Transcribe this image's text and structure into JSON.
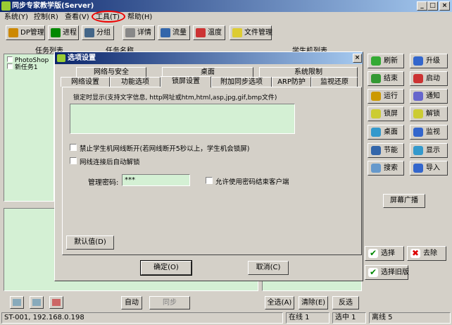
{
  "window": {
    "title": "同步专家教学版(Server)"
  },
  "menu": {
    "m0": "系统(Y)",
    "m1": "控制(R)",
    "m2": "查看(V)",
    "m3": "工具(T)",
    "m4": "帮助(H)"
  },
  "toolbar": {
    "t0": "DP管理",
    "t1": "进程",
    "t2": "分组",
    "t3": "详情",
    "t4": "流量",
    "t5": "温度",
    "t6": "文件管理"
  },
  "left": {
    "header_tasks": "任务列表",
    "header_names": "任务名称",
    "items": [
      "PhotoShop",
      "新任务1"
    ]
  },
  "right": {
    "header_students": "学生机列表",
    "buttons": {
      "b0": "刷新",
      "b1": "升级",
      "b2": "结束",
      "b3": "启动",
      "b4": "运行",
      "b5": "通知",
      "b6": "锁屏",
      "b7": "解锁",
      "b8": "桌面",
      "b9": "监视",
      "b10": "节能",
      "b11": "显示",
      "b12": "搜索",
      "b13": "导入"
    },
    "broadcast": "屏幕广播",
    "select": "选择",
    "remove": "去除",
    "select_old": "选择旧版"
  },
  "bottom": {
    "auto": "自动",
    "sync": "同步",
    "select_all": "全选(A)",
    "clear": "清除(E)",
    "invert": "反选"
  },
  "dialog": {
    "title": "选项设置",
    "ok": "确定(O)",
    "cancel": "取消(C)",
    "tabs_row1": [
      "网络与安全",
      "桌面",
      "系统限制"
    ],
    "tabs_row2": [
      "网络设置",
      "功能选项",
      "锁屏设置",
      "附加同步选项",
      "ARP防护",
      "监视还原"
    ],
    "label_lock_text": "锁定时显示(支持文字信息, http网址或htm,html,asp,jpg,gif,bmp文件)",
    "cb_disconnect": "禁止学生机网线断开(若网线断开5秒以上，学生机会锁屏)",
    "cb_auto_unlock": "网线连接后自动解锁",
    "password_label": "管理密码:",
    "password_value": "***",
    "cb_allow_pwd": "允许使用密码结束客户端",
    "default_btn": "默认值(D)"
  },
  "status": {
    "addr": "ST-001, 192.168.0.198",
    "online": "在线 1",
    "selected": "选中 1",
    "offline": "离线 5"
  },
  "colors": {
    "title_start": "#0a246a",
    "title_end": "#a6caf0",
    "list_bg": "#d4f0d4",
    "highlight": "#e00000"
  }
}
